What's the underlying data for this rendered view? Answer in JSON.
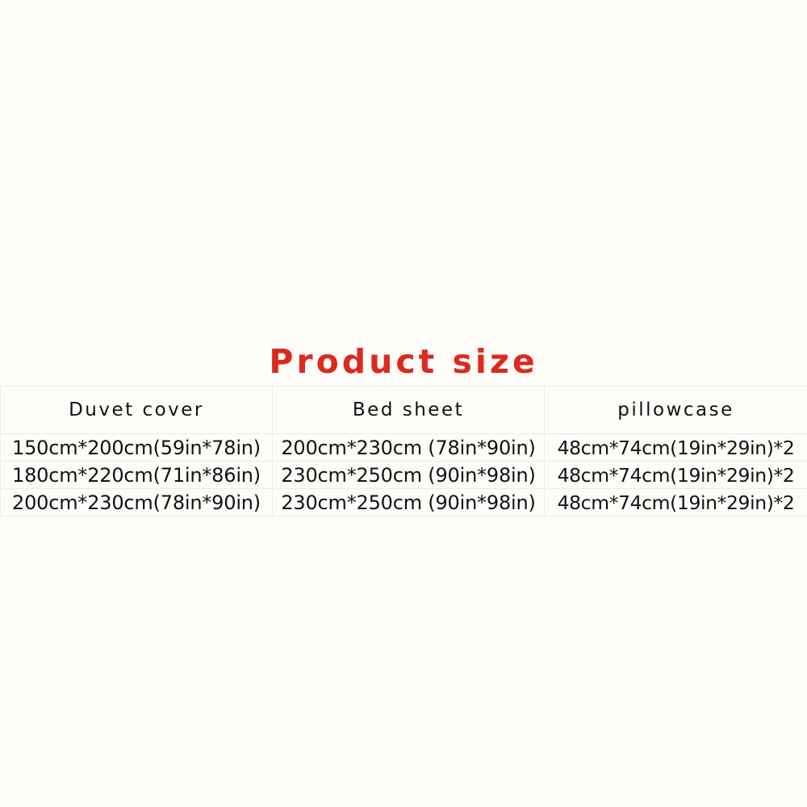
{
  "page": {
    "background_color": "#fefdfa",
    "accent_color": "#dd2a1e",
    "text_color": "#121212",
    "border_color": "#eceaea"
  },
  "title": "Product size",
  "table": {
    "headers": [
      "Duvet  cover",
      "Bed sheet",
      "pillowcase"
    ],
    "rows": [
      {
        "duvet_cover": "150cm*200cm(59in*78in)",
        "bed_sheet": "200cm*230cm (78in*90in)",
        "pillowcase": "48cm*74cm(19in*29in)*2"
      },
      {
        "duvet_cover": "180cm*220cm(71in*86in)",
        "bed_sheet": "230cm*250cm (90in*98in)",
        "pillowcase": "48cm*74cm(19in*29in)*2"
      },
      {
        "duvet_cover": "200cm*230cm(78in*90in)",
        "bed_sheet": "230cm*250cm (90in*98in)",
        "pillowcase": "48cm*74cm(19in*29in)*2"
      }
    ]
  }
}
